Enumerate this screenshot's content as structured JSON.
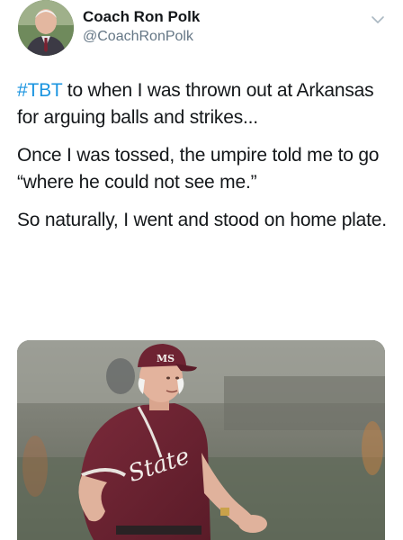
{
  "user": {
    "display_name": "Coach Ron Polk",
    "handle": "@CoachRonPolk"
  },
  "tweet": {
    "hashtag": "#TBT",
    "line1_rest": " to when I was thrown out at Arkansas for arguing balls and strikes...",
    "para2": "Once I was tossed, the umpire told me to go “where he could not see me.”",
    "para3": "So naturally, I went and stood on home plate."
  },
  "media": {
    "jersey_text": "State",
    "cap_logo": "MS"
  },
  "icons": {
    "menu": "chevron-down-icon"
  },
  "colors": {
    "hashtag": "#1b95e0",
    "name": "#14171a",
    "handle": "#657786",
    "jersey": "#6b2232"
  }
}
